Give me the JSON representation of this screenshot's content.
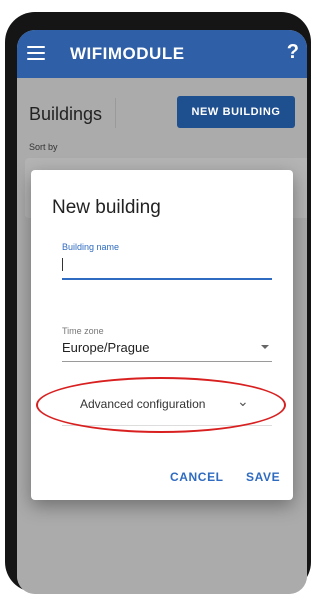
{
  "app_bar": {
    "title": "WIFIMODULE",
    "menu_icon": "hamburger-menu-icon",
    "help_label": "?",
    "color": "#2f5fa6"
  },
  "background": {
    "page_title": "Buildings",
    "new_building_label": "NEW BUILDING",
    "sort_by_label": "Sort by"
  },
  "dialog": {
    "title": "New building",
    "building_name": {
      "label": "Building name",
      "value": ""
    },
    "time_zone": {
      "label": "Time zone",
      "value": "Europe/Prague"
    },
    "advanced": {
      "label": "Advanced configuration",
      "icon": "chevron-down-icon"
    },
    "cancel_label": "CANCEL",
    "save_label": "SAVE",
    "accent_color": "#2f6bc0",
    "highlight_color": "#d92020"
  }
}
